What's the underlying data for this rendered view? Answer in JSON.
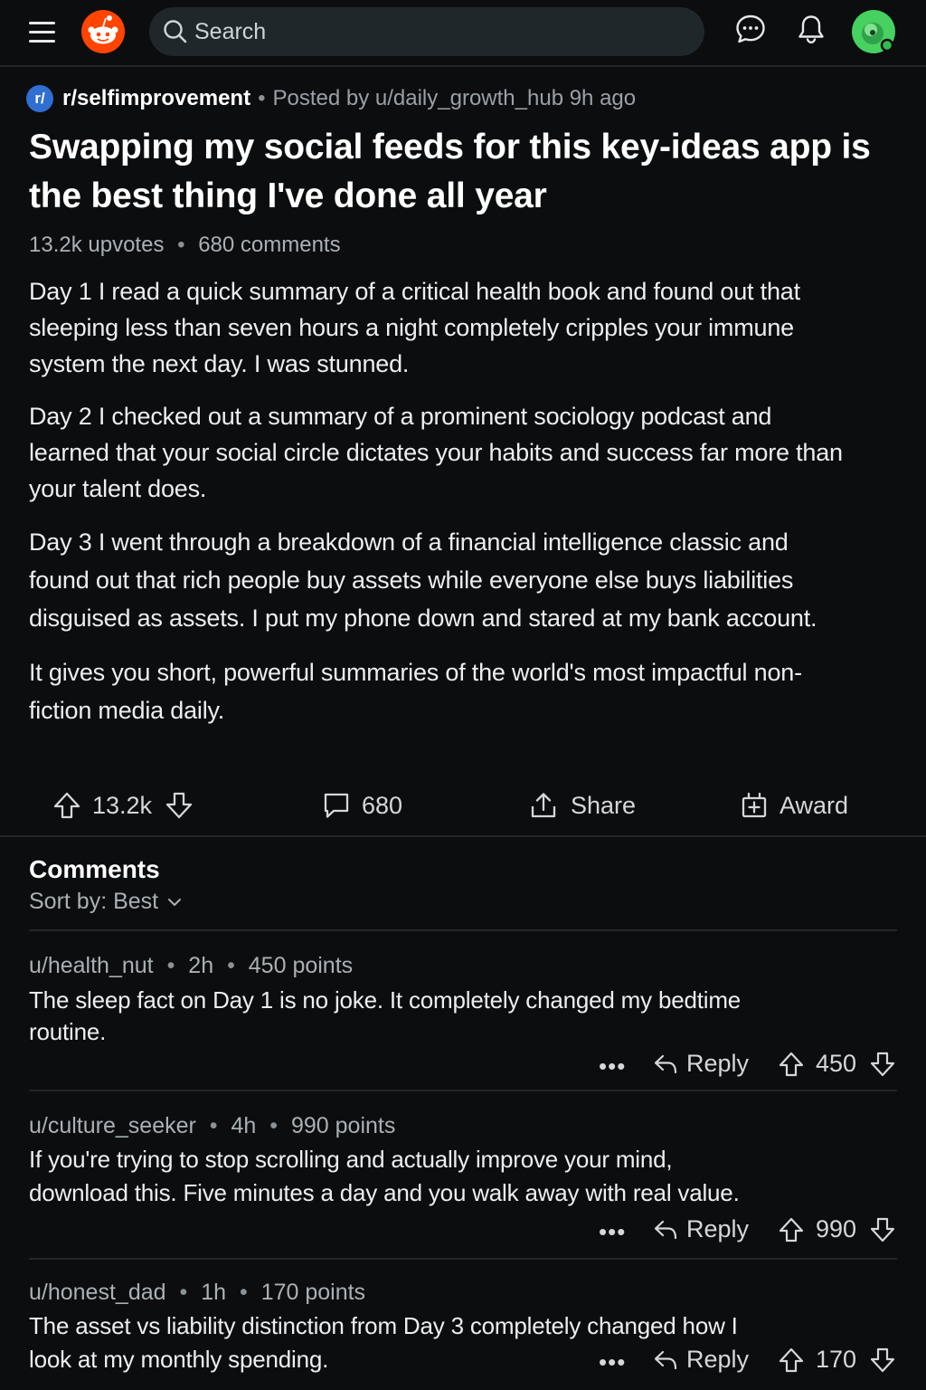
{
  "header": {
    "search_placeholder": "Search",
    "icons": [
      "menu-icon",
      "reddit-logo",
      "search-icon",
      "chat-icon",
      "bell-icon",
      "avatar"
    ]
  },
  "post": {
    "subreddit": "r/selfimprovement",
    "posted_by": "Posted by u/daily_growth_hub 9h ago",
    "title": "Swapping my social feeds for this key-ideas app is the best thing I've done all year",
    "upvotes_text": "13.2k upvotes",
    "comments_text": "680 comments",
    "paragraphs": [
      "Day 1 I read a quick summary of a critical health book and found out that sleeping less than seven hours a night completely cripples your immune system the next day. I was stunned.",
      "Day 2 I checked out a summary of a prominent sociology podcast and learned that your social circle dictates your habits and success far more than your talent does.",
      "Day 3 I went through a breakdown of a financial intelligence classic and found out that rich people buy assets while everyone else buys liabilities disguised as assets. I put my phone down and stared at my bank account.",
      "It gives you short, powerful summaries of the world's most impactful non-fiction media daily."
    ],
    "actions": {
      "votes": "13.2k",
      "comments": "680",
      "share": "Share",
      "award": "Award"
    }
  },
  "comments_section": {
    "title": "Comments",
    "sort_label": "Sort by: Best",
    "items": [
      {
        "user": "u/health_nut",
        "age": "2h",
        "points": "450 points",
        "body": "The sleep fact on Day 1 is no joke. It completely changed my bedtime routine.",
        "more": "•••",
        "reply": "Reply",
        "score": "450"
      },
      {
        "user": "u/culture_seeker",
        "age": "4h",
        "points": "990 points",
        "body": "If you're trying to stop scrolling and actually improve your mind, download this. Five minutes a day and you walk away with real value.",
        "more": "•••",
        "reply": "Reply",
        "score": "990"
      },
      {
        "user": "u/honest_dad",
        "age": "1h",
        "points": "170 points",
        "body": "The asset vs liability distinction from Day 3 completely changed how I look at my monthly spending.",
        "more": "•••",
        "reply": "Reply",
        "score": "170"
      }
    ]
  },
  "colors": {
    "background": "#0b0d0f",
    "brand_orange": "#ff4500",
    "subreddit_icon": "#2f6fd1",
    "avatar_green": "#46d160"
  }
}
